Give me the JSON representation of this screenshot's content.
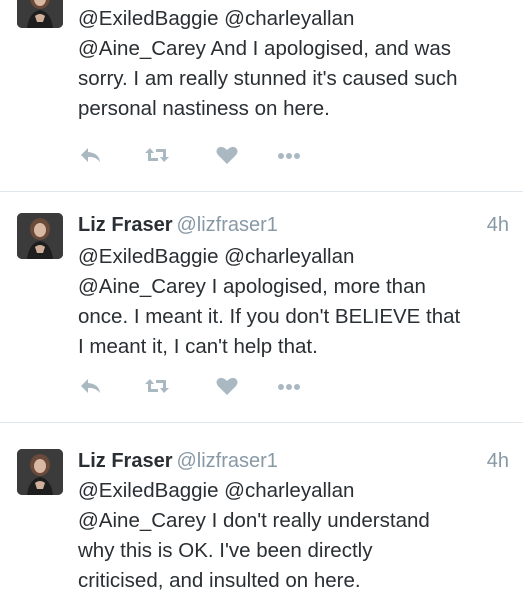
{
  "tweets": [
    {
      "name": "",
      "handle": "",
      "time": "",
      "lines": [
        "@ExiledBaggie @charleyallan",
        "@Aine_Carey And I apologised, and was",
        "sorry. I am really stunned it's caused such",
        "personal nastiness on here."
      ]
    },
    {
      "name": "Liz Fraser",
      "handle": "@lizfraser1",
      "time": "4h",
      "lines": [
        "@ExiledBaggie @charleyallan",
        "@Aine_Carey I apologised, more than",
        "once. I meant it. If you don't BELIEVE that",
        "I meant it, I can't help that."
      ]
    },
    {
      "name": "Liz Fraser",
      "handle": "@lizfraser1",
      "time": "4h",
      "lines": [
        "@ExiledBaggie @charleyallan",
        "@Aine_Carey I don't really understand",
        "why this is OK. I've been directly",
        "criticised, and insulted on here."
      ]
    }
  ],
  "icons": {
    "reply": "reply-icon",
    "retweet": "retweet-icon",
    "like": "heart-icon",
    "more": "more-dots-icon"
  },
  "colors": {
    "icon_gray": "#aab8c2",
    "meta_gray": "#8899a6",
    "text": "#292f33",
    "divider": "#e1e8ed"
  }
}
